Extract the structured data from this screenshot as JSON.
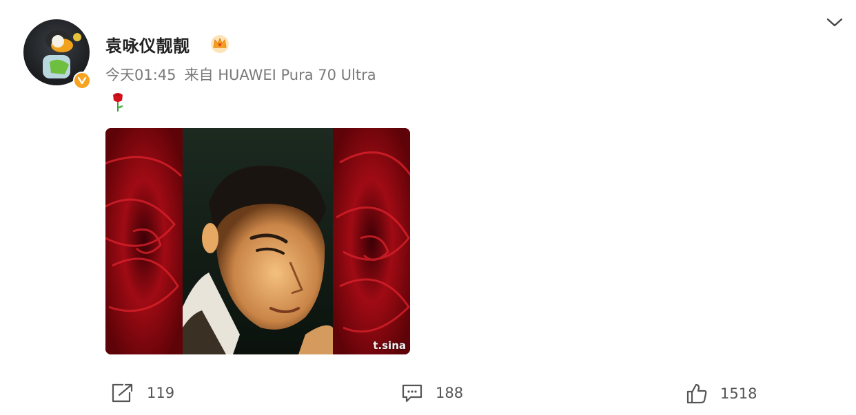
{
  "post": {
    "username": "袁咏仪靓靓",
    "time": "今天01:45",
    "source": "来自 HUAWEI Pura 70 Ultra",
    "emoji": "rose-emoji",
    "watermark": "t.sina",
    "actions": {
      "share_count": "119",
      "comment_count": "188",
      "like_count": "1518"
    }
  },
  "icons": {
    "verified": "verified-badge-icon",
    "crown": "crown-icon",
    "chevron": "chevron-down-icon",
    "share": "share-icon",
    "comment": "comment-icon",
    "like": "thumbs-up-icon"
  },
  "colors": {
    "username": "#222222",
    "meta": "#7a7a7a",
    "verified": "#f7a320",
    "rose": "#b10d15"
  }
}
